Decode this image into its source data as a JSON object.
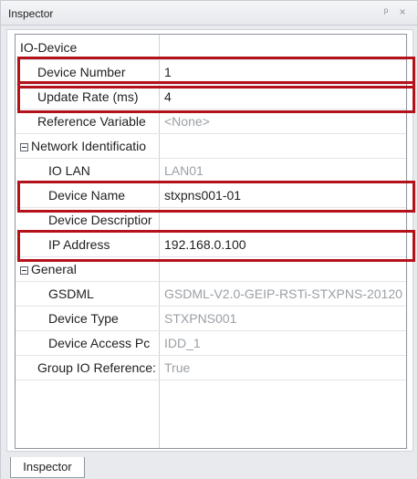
{
  "window": {
    "title": "Inspector"
  },
  "icons": {
    "pin": "pin-icon",
    "close": "close-icon"
  },
  "grid": {
    "rows": [
      {
        "name": "IO-Device",
        "value": ""
      },
      {
        "name": "Device Number",
        "value": "1"
      },
      {
        "name": "Update Rate (ms)",
        "value": "4"
      },
      {
        "name": "Reference Variable",
        "value": "<None>"
      },
      {
        "name": "Network Identificatio",
        "value": ""
      },
      {
        "name": "IO LAN",
        "value": "LAN01"
      },
      {
        "name": "Device Name",
        "value": "stxpns001-01"
      },
      {
        "name": "Device Descriptior",
        "value": ""
      },
      {
        "name": "IP Address",
        "value": "192.168.0.100"
      },
      {
        "name": "General",
        "value": ""
      },
      {
        "name": "GSDML",
        "value": "GSDML-V2.0-GEIP-RSTi-STXPNS-20120"
      },
      {
        "name": "Device Type",
        "value": "STXPNS001"
      },
      {
        "name": "Device Access Pc",
        "value": "IDD_1"
      },
      {
        "name": "Group IO Reference:",
        "value": "True"
      }
    ]
  },
  "bottom_tabs": {
    "active": "Inspector"
  },
  "colors": {
    "highlight": "#b4121b",
    "grid_border": "#8d949e",
    "muted_text": "#9aa0a6"
  }
}
